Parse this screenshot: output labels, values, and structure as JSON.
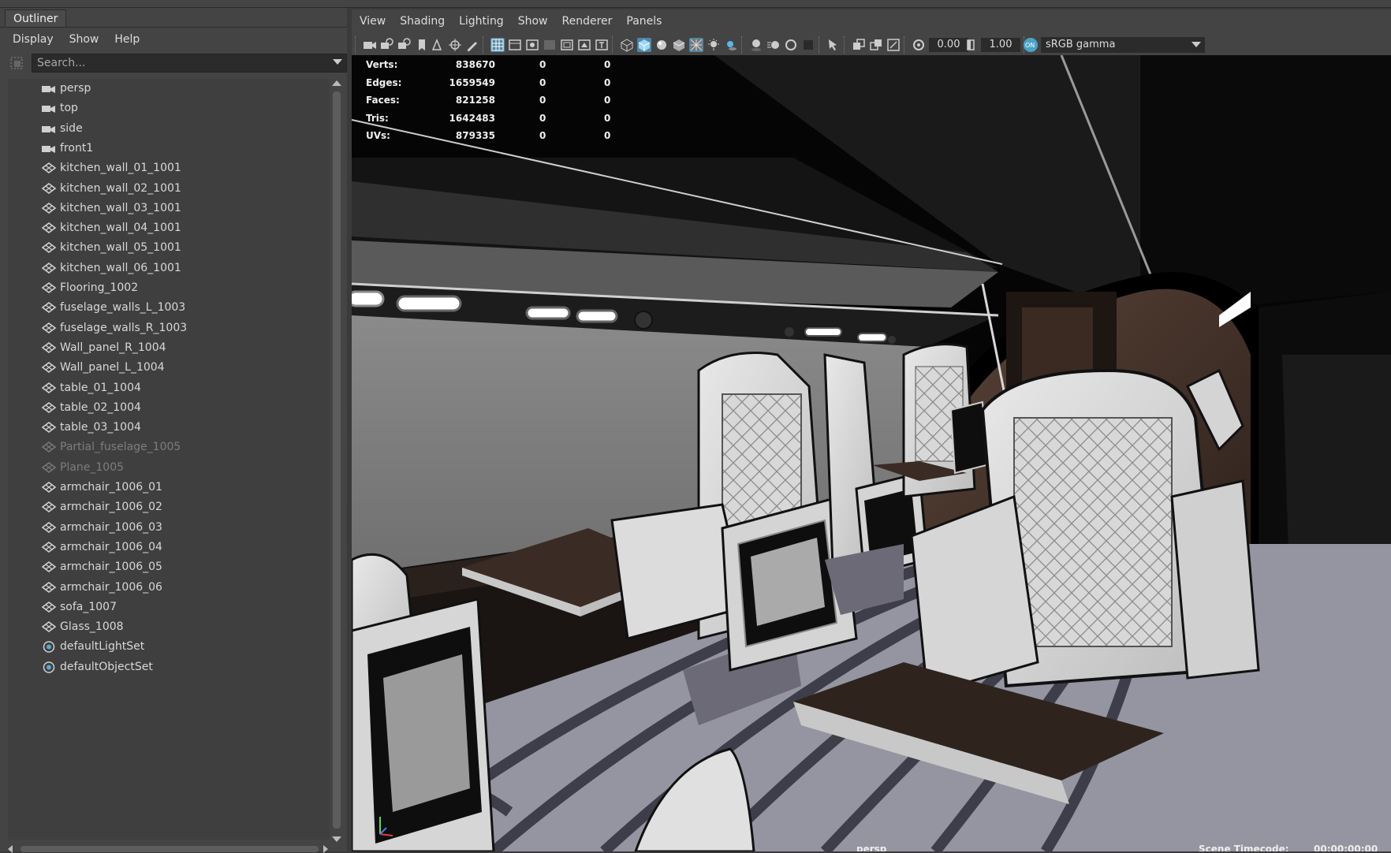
{
  "outliner": {
    "tab_title": "Outliner",
    "menu": [
      "Display",
      "Show",
      "Help"
    ],
    "search_placeholder": "Search...",
    "items": [
      {
        "label": "persp",
        "icon": "camera-icon",
        "dim": false
      },
      {
        "label": "top",
        "icon": "camera-icon",
        "dim": false
      },
      {
        "label": "side",
        "icon": "camera-icon",
        "dim": false
      },
      {
        "label": "front1",
        "icon": "camera-icon",
        "dim": false
      },
      {
        "label": "kitchen_wall_01_1001",
        "icon": "mesh-icon",
        "dim": false
      },
      {
        "label": "kitchen_wall_02_1001",
        "icon": "mesh-icon",
        "dim": false
      },
      {
        "label": "kitchen_wall_03_1001",
        "icon": "mesh-icon",
        "dim": false
      },
      {
        "label": "kitchen_wall_04_1001",
        "icon": "mesh-icon",
        "dim": false
      },
      {
        "label": "kitchen_wall_05_1001",
        "icon": "mesh-icon",
        "dim": false
      },
      {
        "label": "kitchen_wall_06_1001",
        "icon": "mesh-icon",
        "dim": false
      },
      {
        "label": "Flooring_1002",
        "icon": "mesh-icon",
        "dim": false
      },
      {
        "label": "fuselage_walls_L_1003",
        "icon": "mesh-icon",
        "dim": false
      },
      {
        "label": "fuselage_walls_R_1003",
        "icon": "mesh-icon",
        "dim": false
      },
      {
        "label": "Wall_panel_R_1004",
        "icon": "mesh-icon",
        "dim": false
      },
      {
        "label": "Wall_panel_L_1004",
        "icon": "mesh-icon",
        "dim": false
      },
      {
        "label": "table_01_1004",
        "icon": "mesh-icon",
        "dim": false
      },
      {
        "label": "table_02_1004",
        "icon": "mesh-icon",
        "dim": false
      },
      {
        "label": "table_03_1004",
        "icon": "mesh-icon",
        "dim": false
      },
      {
        "label": "Partial_fuselage_1005",
        "icon": "mesh-icon",
        "dim": true
      },
      {
        "label": "Plane_1005",
        "icon": "mesh-icon",
        "dim": true
      },
      {
        "label": "armchair_1006_01",
        "icon": "mesh-icon",
        "dim": false
      },
      {
        "label": "armchair_1006_02",
        "icon": "mesh-icon",
        "dim": false
      },
      {
        "label": "armchair_1006_03",
        "icon": "mesh-icon",
        "dim": false
      },
      {
        "label": "armchair_1006_04",
        "icon": "mesh-icon",
        "dim": false
      },
      {
        "label": "armchair_1006_05",
        "icon": "mesh-icon",
        "dim": false
      },
      {
        "label": "armchair_1006_06",
        "icon": "mesh-icon",
        "dim": false
      },
      {
        "label": "sofa_1007",
        "icon": "mesh-icon",
        "dim": false
      },
      {
        "label": "Glass_1008",
        "icon": "mesh-icon",
        "dim": false
      },
      {
        "label": "defaultLightSet",
        "icon": "set-icon",
        "dim": false
      },
      {
        "label": "defaultObjectSet",
        "icon": "set-icon",
        "dim": false
      }
    ]
  },
  "viewport": {
    "menu": [
      "View",
      "Shading",
      "Lighting",
      "Show",
      "Renderer",
      "Panels"
    ],
    "exposure": "0.00",
    "gamma": "1.00",
    "color_space": "sRGB gamma",
    "hud": [
      {
        "label": "Verts:",
        "value": "838670",
        "v2": "0",
        "v3": "0"
      },
      {
        "label": "Edges:",
        "value": "1659549",
        "v2": "0",
        "v3": "0"
      },
      {
        "label": "Faces:",
        "value": "821258",
        "v2": "0",
        "v3": "0"
      },
      {
        "label": "Tris:",
        "value": "1642483",
        "v2": "0",
        "v3": "0"
      },
      {
        "label": "UVs:",
        "value": "879335",
        "v2": "0",
        "v3": "0"
      }
    ],
    "camera_name": "persp",
    "timecode_label": "Scene Timecode:",
    "timecode_value": "00:00:00:00"
  }
}
